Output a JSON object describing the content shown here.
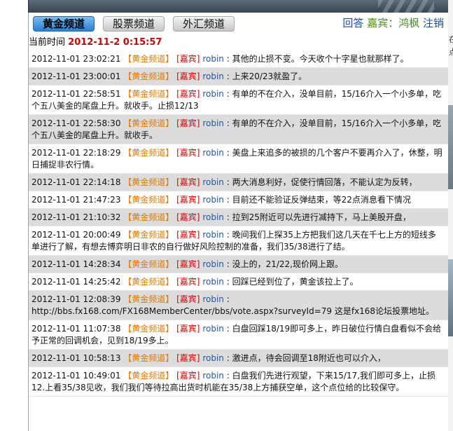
{
  "tabs": [
    {
      "label": "黄金频道",
      "active": true
    },
    {
      "label": "股票频道",
      "active": false
    },
    {
      "label": "外汇频道",
      "active": false
    }
  ],
  "topright": {
    "reply": "回答",
    "guest": "嘉宾：鸿枫",
    "logout": "注销"
  },
  "timebar": {
    "label": "当前时间",
    "value": "2012-11-2 0:15:57"
  },
  "messages": [
    {
      "time": "2012-11-01 23:02:21",
      "channel": "【黄金频道】",
      "role": "[嘉宾]",
      "author": "robin",
      "text": ": 其他的止损不变。今天收个十字星也就那样了。"
    },
    {
      "time": "2012-11-01 23:00:01",
      "channel": "【黄金频道】",
      "role": "[嘉宾]",
      "author": "robin",
      "text": ": 上来20/23就盈了。"
    },
    {
      "time": "2012-11-01 22:58:51",
      "channel": "【黄金频道】",
      "role": "[嘉宾]",
      "author": "robin",
      "text": ": 有单的不在介入，没单目前，15/16介入一个小多单，吃个五八美金的尾盘上升。就收手。止损12/13"
    },
    {
      "time": "2012-11-01 22:58:30",
      "channel": "【黄金频道】",
      "role": "[嘉宾]",
      "author": "robin",
      "text": ": 有单的不在介入，没单目前，15/16介入一个小多单，吃个五八美金的尾盘上升。就收手。"
    },
    {
      "time": "2012-11-01 22:18:29",
      "channel": "【黄金频道】",
      "role": "[嘉宾]",
      "author": "robin",
      "text": ": 美盘上来追多的被损的几个客户不要再介入了，休整，明日捕捉非农行情。"
    },
    {
      "time": "2012-11-01 22:14:18",
      "channel": "【黄金频道】",
      "role": "[嘉宾]",
      "author": "robin",
      "text": ": 两大消息利好，促使行情回落，不能认定为反转，"
    },
    {
      "time": "2012-11-01 21:47:23",
      "channel": "【黄金频道】",
      "role": "[嘉宾]",
      "author": "robin",
      "text": ": 目前还不能验证反弹结束，等22点消息看下情况"
    },
    {
      "time": "2012-11-01 21:10:32",
      "channel": "【黄金频道】",
      "role": "[嘉宾]",
      "author": "robin",
      "text": ": 拉到25附近可以先进行减持下，马上美股开盘，"
    },
    {
      "time": "2012-11-01 20:00:49",
      "channel": "【黄金频道】",
      "role": "[嘉宾]",
      "author": "robin",
      "text": ": 晚间我们上探35上方把我们这几天在千七上方的短线多单进行了解，有想去博弈明日非农的自行做好风险控制的准备，我们35/38进行了结。"
    },
    {
      "time": "2012-11-01 14:28:34",
      "channel": "【黄金频道】",
      "role": "[嘉宾]",
      "author": "robin",
      "text": ": 没上的，21/22,现价网上跟。"
    },
    {
      "time": "2012-11-01 14:25:42",
      "channel": "【黄金频道】",
      "role": "[嘉宾]",
      "author": "robin",
      "text": ": 回踩已经到位了，黄金该拉上了。"
    },
    {
      "time": "2012-11-01 12:08:39",
      "channel": "【黄金频道】",
      "role": "[嘉宾]",
      "author": "robin",
      "text": ": http://bbs.fx168.com/FX168MemberCenter/bbs/vote.aspx?surveyId=79 这是fx168论坛投票地址。"
    },
    {
      "time": "2012-11-01 11:07:38",
      "channel": "【黄金频道】",
      "role": "[嘉宾]",
      "author": "robin",
      "text": ": 白盘回踩18/19即可多上，昨日破位行情白盘看似不会给予正常的回调机会，见到18/19多上。"
    },
    {
      "time": "2012-11-01 10:58:13",
      "channel": "【黄金频道】",
      "role": "[嘉宾]",
      "author": "robin",
      "text": ": 激进点，待会回调至18附近也可以介入，"
    },
    {
      "time": "2012-11-01 10:49:01",
      "channel": "【黄金频道】",
      "role": "[嘉宾]",
      "author": "robin",
      "text": ": 白盘我们先进行观望，下来15/17,我们即可多上，止损12.上看35/38见收，我们我们等待拉高出货时机能在35/38上方捕获空单，这个点位给的比较保守。"
    }
  ],
  "right_fragments": [
    "在",
    "点"
  ]
}
